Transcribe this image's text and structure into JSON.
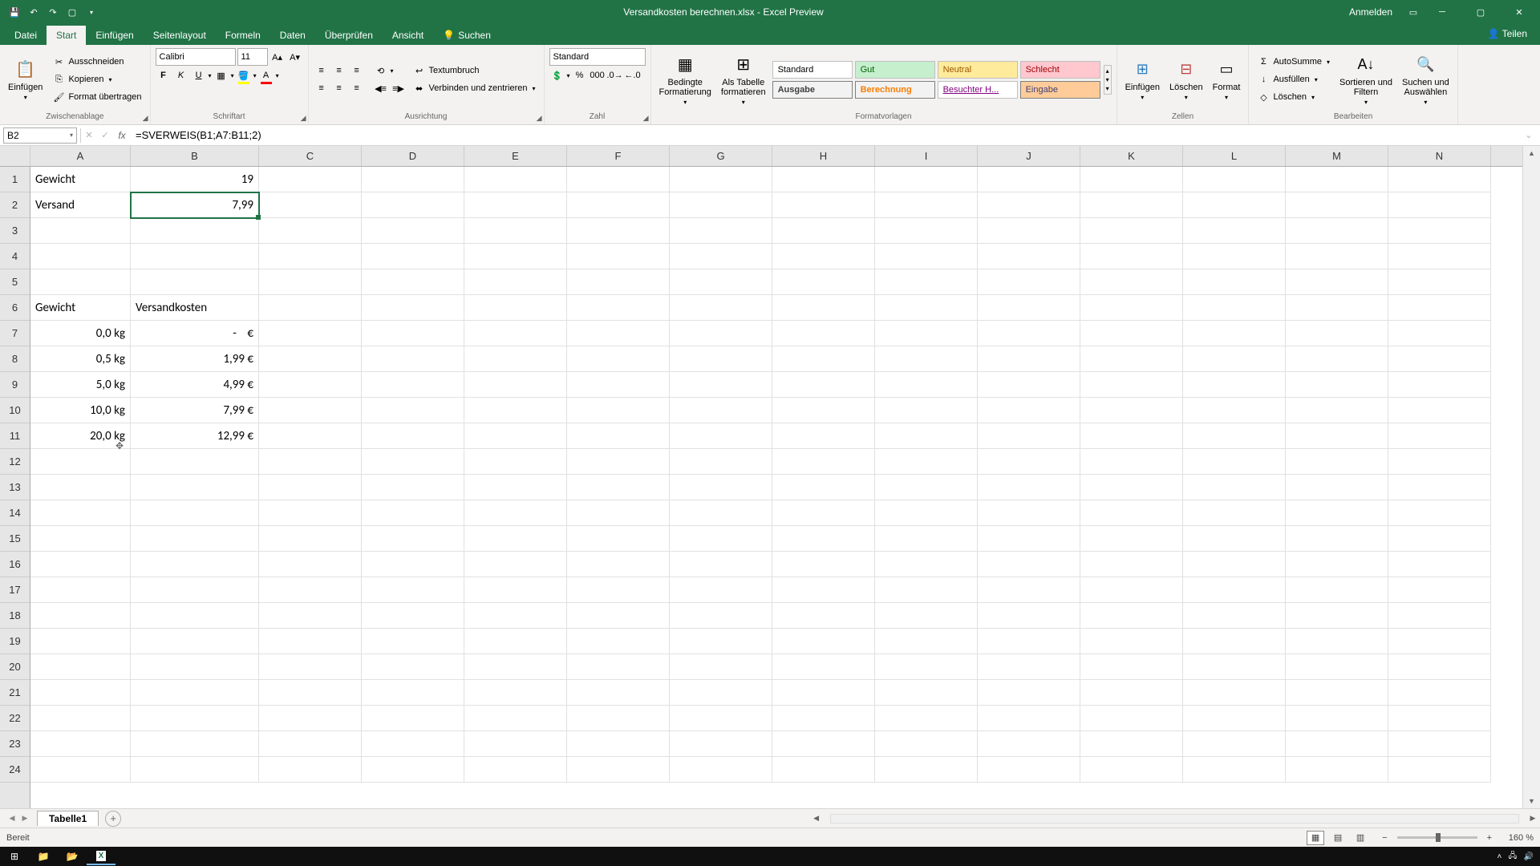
{
  "titlebar": {
    "title": "Versandkosten berechnen.xlsx - Excel Preview",
    "signin": "Anmelden"
  },
  "menu": {
    "datei": "Datei",
    "start": "Start",
    "einfuegen": "Einfügen",
    "seitenlayout": "Seitenlayout",
    "formeln": "Formeln",
    "daten": "Daten",
    "ueberpruefen": "Überprüfen",
    "ansicht": "Ansicht",
    "suchen": "Suchen",
    "teilen": "Teilen"
  },
  "ribbon": {
    "clipboard": {
      "group": "Zwischenablage",
      "paste": "Einfügen",
      "cut": "Ausschneiden",
      "copy": "Kopieren",
      "format_painter": "Format übertragen"
    },
    "font": {
      "group": "Schriftart",
      "name": "Calibri",
      "size": "11"
    },
    "align": {
      "group": "Ausrichtung",
      "wrap": "Textumbruch",
      "merge": "Verbinden und zentrieren"
    },
    "number": {
      "group": "Zahl",
      "format": "Standard"
    },
    "styles": {
      "group": "Formatvorlagen",
      "cond": "Bedingte\nFormatierung",
      "table": "Als Tabelle\nformatieren",
      "s1": "Standard",
      "s2": "Gut",
      "s3": "Neutral",
      "s4": "Schlecht",
      "s5": "Ausgabe",
      "s6": "Berechnung",
      "s7": "Besuchter H...",
      "s8": "Eingabe"
    },
    "cells": {
      "group": "Zellen",
      "insert": "Einfügen",
      "delete": "Löschen",
      "format": "Format"
    },
    "editing": {
      "group": "Bearbeiten",
      "sum": "AutoSumme",
      "fill": "Ausfüllen",
      "clear": "Löschen",
      "sort": "Sortieren und\nFiltern",
      "find": "Suchen und\nAuswählen"
    }
  },
  "namebox": "B2",
  "formula": "=SVERWEIS(B1;A7:B11;2)",
  "columns": [
    "A",
    "B",
    "C",
    "D",
    "E",
    "F",
    "G",
    "H",
    "I",
    "J",
    "K",
    "L",
    "M",
    "N"
  ],
  "rows": {
    "r1": {
      "a": "Gewicht",
      "b": "19"
    },
    "r2": {
      "a": "Versand",
      "b": "7,99"
    },
    "r6": {
      "a": "Gewicht",
      "b": "Versandkosten"
    },
    "r7": {
      "a": "0,0 kg",
      "b": "-    €"
    },
    "r8": {
      "a": "0,5 kg",
      "b": "1,99 €"
    },
    "r9": {
      "a": "5,0 kg",
      "b": "4,99 €"
    },
    "r10": {
      "a": "10,0 kg",
      "b": "7,99 €"
    },
    "r11": {
      "a": "20,0 kg",
      "b": "12,99 €"
    }
  },
  "sheet_tab": "Tabelle1",
  "status": {
    "ready": "Bereit",
    "zoom": "160 %"
  }
}
